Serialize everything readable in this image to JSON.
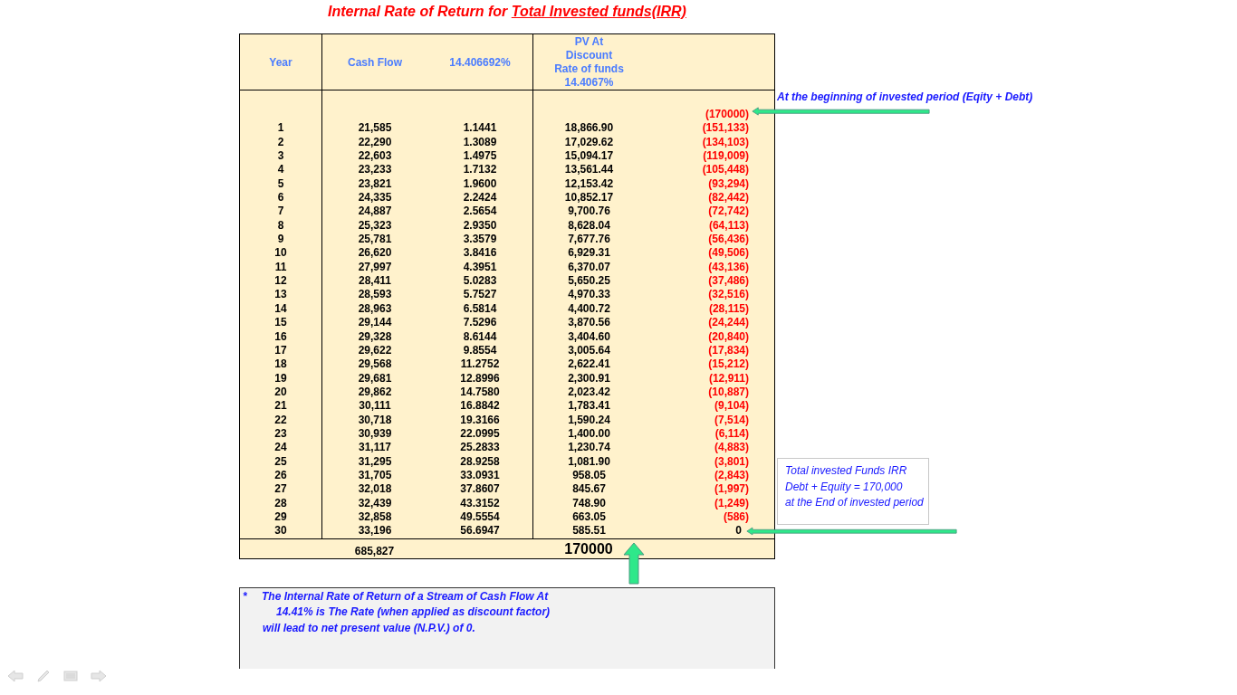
{
  "title": {
    "prefix": "Internal Rate of Return for",
    "underlined": "Total Invested funds(IRR)"
  },
  "table": {
    "header": {
      "year": "Year",
      "cash_flow": "Cash Flow",
      "factor": "14.406692%",
      "pv": [
        "PV At",
        "Discount",
        "Rate of funds",
        "14.4067%"
      ]
    },
    "opening_balance": "(170000)",
    "rows": [
      {
        "year": "1",
        "cash_flow": "21,585",
        "factor": "1.1441",
        "pv": "18,866.90",
        "balance": "(151,133)",
        "negative": true
      },
      {
        "year": "2",
        "cash_flow": "22,290",
        "factor": "1.3089",
        "pv": "17,029.62",
        "balance": "(134,103)",
        "negative": true
      },
      {
        "year": "3",
        "cash_flow": "22,603",
        "factor": "1.4975",
        "pv": "15,094.17",
        "balance": "(119,009)",
        "negative": true
      },
      {
        "year": "4",
        "cash_flow": "23,233",
        "factor": "1.7132",
        "pv": "13,561.44",
        "balance": "(105,448)",
        "negative": true
      },
      {
        "year": "5",
        "cash_flow": "23,821",
        "factor": "1.9600",
        "pv": "12,153.42",
        "balance": "(93,294)",
        "negative": true
      },
      {
        "year": "6",
        "cash_flow": "24,335",
        "factor": "2.2424",
        "pv": "10,852.17",
        "balance": "(82,442)",
        "negative": true
      },
      {
        "year": "7",
        "cash_flow": "24,887",
        "factor": "2.5654",
        "pv": "9,700.76",
        "balance": "(72,742)",
        "negative": true
      },
      {
        "year": "8",
        "cash_flow": "25,323",
        "factor": "2.9350",
        "pv": "8,628.04",
        "balance": "(64,113)",
        "negative": true
      },
      {
        "year": "9",
        "cash_flow": "25,781",
        "factor": "3.3579",
        "pv": "7,677.76",
        "balance": "(56,436)",
        "negative": true
      },
      {
        "year": "10",
        "cash_flow": "26,620",
        "factor": "3.8416",
        "pv": "6,929.31",
        "balance": "(49,506)",
        "negative": true
      },
      {
        "year": "11",
        "cash_flow": "27,997",
        "factor": "4.3951",
        "pv": "6,370.07",
        "balance": "(43,136)",
        "negative": true
      },
      {
        "year": "12",
        "cash_flow": "28,411",
        "factor": "5.0283",
        "pv": "5,650.25",
        "balance": "(37,486)",
        "negative": true
      },
      {
        "year": "13",
        "cash_flow": "28,593",
        "factor": "5.7527",
        "pv": "4,970.33",
        "balance": "(32,516)",
        "negative": true
      },
      {
        "year": "14",
        "cash_flow": "28,963",
        "factor": "6.5814",
        "pv": "4,400.72",
        "balance": "(28,115)",
        "negative": true
      },
      {
        "year": "15",
        "cash_flow": "29,144",
        "factor": "7.5296",
        "pv": "3,870.56",
        "balance": "(24,244)",
        "negative": true
      },
      {
        "year": "16",
        "cash_flow": "29,328",
        "factor": "8.6144",
        "pv": "3,404.60",
        "balance": "(20,840)",
        "negative": true
      },
      {
        "year": "17",
        "cash_flow": "29,622",
        "factor": "9.8554",
        "pv": "3,005.64",
        "balance": "(17,834)",
        "negative": true
      },
      {
        "year": "18",
        "cash_flow": "29,568",
        "factor": "11.2752",
        "pv": "2,622.41",
        "balance": "(15,212)",
        "negative": true
      },
      {
        "year": "19",
        "cash_flow": "29,681",
        "factor": "12.8996",
        "pv": "2,300.91",
        "balance": "(12,911)",
        "negative": true
      },
      {
        "year": "20",
        "cash_flow": "29,862",
        "factor": "14.7580",
        "pv": "2,023.42",
        "balance": "(10,887)",
        "negative": true
      },
      {
        "year": "21",
        "cash_flow": "30,111",
        "factor": "16.8842",
        "pv": "1,783.41",
        "balance": "(9,104)",
        "negative": true
      },
      {
        "year": "22",
        "cash_flow": "30,718",
        "factor": "19.3166",
        "pv": "1,590.24",
        "balance": "(7,514)",
        "negative": true
      },
      {
        "year": "23",
        "cash_flow": "30,939",
        "factor": "22.0995",
        "pv": "1,400.00",
        "balance": "(6,114)",
        "negative": true
      },
      {
        "year": "24",
        "cash_flow": "31,117",
        "factor": "25.2833",
        "pv": "1,230.74",
        "balance": "(4,883)",
        "negative": true
      },
      {
        "year": "25",
        "cash_flow": "31,295",
        "factor": "28.9258",
        "pv": "1,081.90",
        "balance": "(3,801)",
        "negative": true
      },
      {
        "year": "26",
        "cash_flow": "31,705",
        "factor": "33.0931",
        "pv": "958.05",
        "balance": "(2,843)",
        "negative": true
      },
      {
        "year": "27",
        "cash_flow": "32,018",
        "factor": "37.8607",
        "pv": "845.67",
        "balance": "(1,997)",
        "negative": true
      },
      {
        "year": "28",
        "cash_flow": "32,439",
        "factor": "43.3152",
        "pv": "748.90",
        "balance": "(1,249)",
        "negative": true
      },
      {
        "year": "29",
        "cash_flow": "32,858",
        "factor": "49.5554",
        "pv": "663.05",
        "balance": "(586)",
        "negative": true
      },
      {
        "year": "30",
        "cash_flow": "33,196",
        "factor": "56.6947",
        "pv": "585.51",
        "balance": "0",
        "negative": false
      }
    ],
    "totals": {
      "cash_flow": "685,827",
      "pv": "170000"
    }
  },
  "annotation_top": "At the beginning of invested period (Eqity + Debt)",
  "annotation_box": [
    "Total invested Funds IRR",
    "Debt  + Equity = 170,000",
    "at the End of invested period"
  ],
  "note": {
    "marker": "*",
    "lines": [
      "The Internal Rate of Return of a Stream of Cash Flow At",
      "14.41%  is The Rate (when applied as discount factor)",
      "will lead to net present value (N.P.V.) of 0."
    ]
  }
}
